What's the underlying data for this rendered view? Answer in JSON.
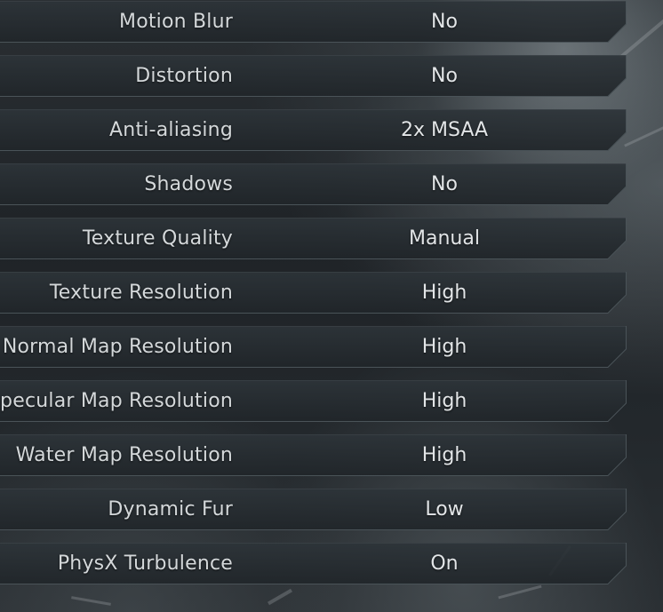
{
  "settings": [
    {
      "label": "Motion Blur",
      "value": "No"
    },
    {
      "label": "Distortion",
      "value": "No"
    },
    {
      "label": "Anti-aliasing",
      "value": "2x MSAA"
    },
    {
      "label": "Shadows",
      "value": "No"
    },
    {
      "label": "Texture Quality",
      "value": "Manual"
    },
    {
      "label": "Texture Resolution",
      "value": "High"
    },
    {
      "label": "Normal Map Resolution",
      "value": "High"
    },
    {
      "label": "Specular Map Resolution",
      "value": "High"
    },
    {
      "label": "Water Map Resolution",
      "value": "High"
    },
    {
      "label": "Dynamic Fur",
      "value": "Low"
    },
    {
      "label": "PhysX Turbulence",
      "value": "On"
    }
  ],
  "colors": {
    "text": "#d4d8da",
    "row_background": "#283035",
    "row_border": "#4a5358"
  }
}
